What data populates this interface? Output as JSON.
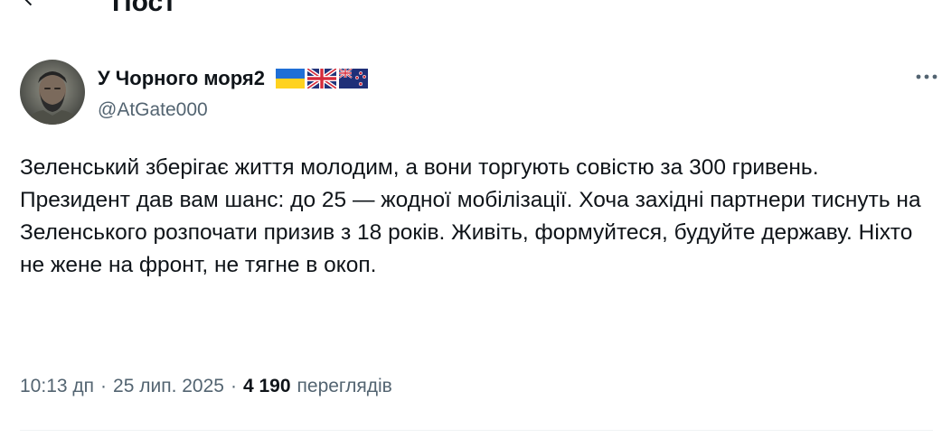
{
  "header": {
    "back_icon": "arrow-left-icon",
    "title": "Пост"
  },
  "author": {
    "display_name": "У Чорного моря2",
    "handle": "@AtGate000",
    "flags": [
      "ukraine-flag-icon",
      "united-kingdom-flag-icon",
      "new-zealand-flag-icon"
    ],
    "more_icon": "more-horizontal-icon"
  },
  "tweet": {
    "paragraph_1": "Зеленський зберігає життя молодим, а вони торгують совістю за 300 гривень.",
    "paragraph_2": "Президент дав вам шанс: до 25 — жодної мобілізації. Хоча західні партнери тиснуть на Зеленського розпочати призив з 18 років. Живіть, формуйтеся, будуйте державу. Ніхто не жене на фронт, не тягне в окоп."
  },
  "meta": {
    "time": "10:13 дп",
    "separator": "·",
    "date": "25 лип. 2025",
    "views_count": "4 190",
    "views_label": "переглядів"
  },
  "colors": {
    "text_primary": "#0f1419",
    "text_secondary": "#536471",
    "divider": "#eff3f4"
  }
}
